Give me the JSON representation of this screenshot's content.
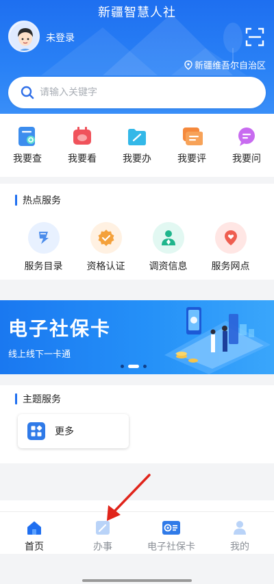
{
  "header": {
    "title": "新疆智慧人社",
    "login_status": "未登录",
    "location": "新疆维吾尔自治区"
  },
  "search": {
    "placeholder": "请输入关键字"
  },
  "quick_actions": [
    {
      "label": "我要查",
      "icon": "search-doc-icon"
    },
    {
      "label": "我要看",
      "icon": "tv-icon"
    },
    {
      "label": "我要办",
      "icon": "folder-edit-icon"
    },
    {
      "label": "我要评",
      "icon": "review-icon"
    },
    {
      "label": "我要问",
      "icon": "chat-question-icon"
    }
  ],
  "hot_services": {
    "title": "热点服务",
    "items": [
      {
        "label": "服务目录",
        "icon": "catalog-icon"
      },
      {
        "label": "资格认证",
        "icon": "certification-badge-icon"
      },
      {
        "label": "调资信息",
        "icon": "salary-person-icon"
      },
      {
        "label": "服务网点",
        "icon": "location-heart-icon"
      }
    ]
  },
  "banner": {
    "title": "电子社保卡",
    "subtitle": "线上线下一卡通",
    "slides": 3,
    "active_slide": 2
  },
  "theme_services": {
    "title": "主题服务",
    "more_label": "更多"
  },
  "tabbar": {
    "tabs": [
      {
        "label": "首页",
        "icon": "home-icon",
        "active": true
      },
      {
        "label": "办事",
        "icon": "edit-icon",
        "active": false
      },
      {
        "label": "电子社保卡",
        "icon": "social-card-icon",
        "active": false
      },
      {
        "label": "我的",
        "icon": "user-icon",
        "active": false
      }
    ]
  },
  "colors": {
    "primary": "#1f6ff0",
    "annotation_arrow": "#e0241b"
  }
}
